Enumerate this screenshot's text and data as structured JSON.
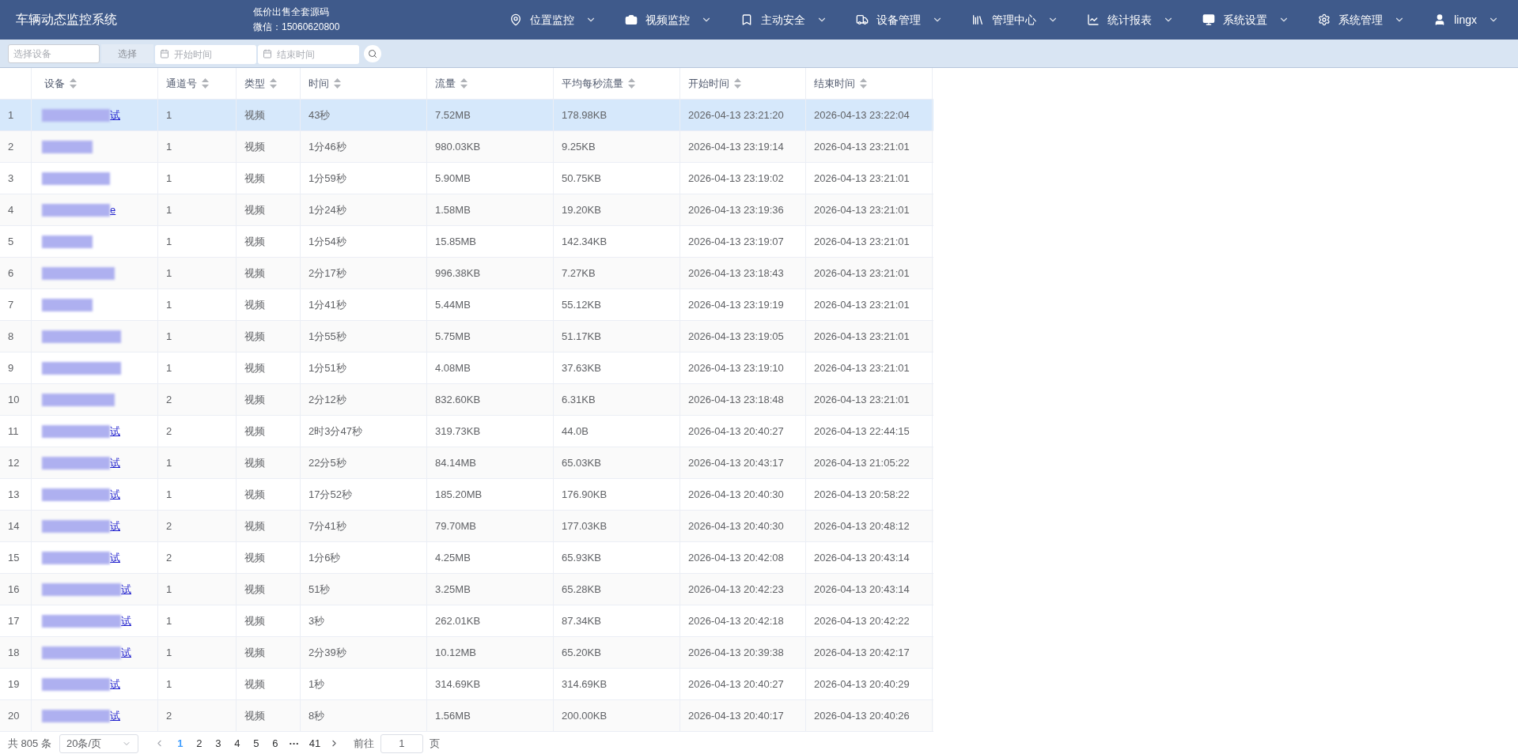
{
  "header": {
    "title": "车辆动态监控系统",
    "promo_line_1": "低价出售全套源码",
    "promo_line_2": "微信：15060620800",
    "nav": [
      {
        "kind": "location",
        "label": "位置监控"
      },
      {
        "kind": "video",
        "label": "视频监控"
      },
      {
        "kind": "safety",
        "label": "主动安全"
      },
      {
        "kind": "device",
        "label": "设备管理"
      },
      {
        "kind": "center",
        "label": "管理中心"
      },
      {
        "kind": "stats",
        "label": "统计报表"
      },
      {
        "kind": "system",
        "label": "系统设置"
      },
      {
        "kind": "admin",
        "label": "系统管理"
      },
      {
        "kind": "user",
        "label": "lingx"
      }
    ]
  },
  "toolbar": {
    "device_placeholder": "选择设备",
    "select_button": "选择",
    "start_placeholder": "开始时间",
    "end_placeholder": "结束时间"
  },
  "table": {
    "columns": [
      "设备",
      "通道号",
      "类型",
      "时间",
      "流量",
      "平均每秒流量",
      "开始时间",
      "结束时间"
    ],
    "rows": [
      {
        "index": "1",
        "device_tail": "试",
        "selected": true,
        "channel": "1",
        "type": "视频",
        "duration": "43秒",
        "traffic": "7.52MB",
        "avg": "178.98KB",
        "start": "2026-04-13 23:21:20",
        "end": "2026-04-13 23:22:04"
      },
      {
        "index": "2",
        "selected": false,
        "channel": "1",
        "type": "视频",
        "duration": "1分46秒",
        "traffic": "980.03KB",
        "avg": "9.25KB",
        "start": "2026-04-13 23:19:14",
        "end": "2026-04-13 23:21:01"
      },
      {
        "index": "3",
        "selected": false,
        "channel": "1",
        "type": "视频",
        "duration": "1分59秒",
        "traffic": "5.90MB",
        "avg": "50.75KB",
        "start": "2026-04-13 23:19:02",
        "end": "2026-04-13 23:21:01"
      },
      {
        "index": "4",
        "device_tail": "e",
        "selected": false,
        "channel": "1",
        "type": "视频",
        "duration": "1分24秒",
        "traffic": "1.58MB",
        "avg": "19.20KB",
        "start": "2026-04-13 23:19:36",
        "end": "2026-04-13 23:21:01"
      },
      {
        "index": "5",
        "selected": false,
        "channel": "1",
        "type": "视频",
        "duration": "1分54秒",
        "traffic": "15.85MB",
        "avg": "142.34KB",
        "start": "2026-04-13 23:19:07",
        "end": "2026-04-13 23:21:01"
      },
      {
        "index": "6",
        "selected": false,
        "channel": "1",
        "type": "视频",
        "duration": "2分17秒",
        "traffic": "996.38KB",
        "avg": "7.27KB",
        "start": "2026-04-13 23:18:43",
        "end": "2026-04-13 23:21:01"
      },
      {
        "index": "7",
        "selected": false,
        "channel": "1",
        "type": "视频",
        "duration": "1分41秒",
        "traffic": "5.44MB",
        "avg": "55.12KB",
        "start": "2026-04-13 23:19:19",
        "end": "2026-04-13 23:21:01"
      },
      {
        "index": "8",
        "selected": false,
        "channel": "1",
        "type": "视频",
        "duration": "1分55秒",
        "traffic": "5.75MB",
        "avg": "51.17KB",
        "start": "2026-04-13 23:19:05",
        "end": "2026-04-13 23:21:01"
      },
      {
        "index": "9",
        "selected": false,
        "channel": "1",
        "type": "视频",
        "duration": "1分51秒",
        "traffic": "4.08MB",
        "avg": "37.63KB",
        "start": "2026-04-13 23:19:10",
        "end": "2026-04-13 23:21:01"
      },
      {
        "index": "10",
        "selected": false,
        "channel": "2",
        "type": "视频",
        "duration": "2分12秒",
        "traffic": "832.60KB",
        "avg": "6.31KB",
        "start": "2026-04-13 23:18:48",
        "end": "2026-04-13 23:21:01"
      },
      {
        "index": "11",
        "device_tail": "试",
        "selected": false,
        "channel": "2",
        "type": "视频",
        "duration": "2时3分47秒",
        "traffic": "319.73KB",
        "avg": "44.0B",
        "start": "2026-04-13 20:40:27",
        "end": "2026-04-13 22:44:15"
      },
      {
        "index": "12",
        "device_tail": "试",
        "selected": false,
        "channel": "1",
        "type": "视频",
        "duration": "22分5秒",
        "traffic": "84.14MB",
        "avg": "65.03KB",
        "start": "2026-04-13 20:43:17",
        "end": "2026-04-13 21:05:22"
      },
      {
        "index": "13",
        "device_tail": "试",
        "selected": false,
        "channel": "1",
        "type": "视频",
        "duration": "17分52秒",
        "traffic": "185.20MB",
        "avg": "176.90KB",
        "start": "2026-04-13 20:40:30",
        "end": "2026-04-13 20:58:22"
      },
      {
        "index": "14",
        "device_tail": "试",
        "selected": false,
        "channel": "2",
        "type": "视频",
        "duration": "7分41秒",
        "traffic": "79.70MB",
        "avg": "177.03KB",
        "start": "2026-04-13 20:40:30",
        "end": "2026-04-13 20:48:12"
      },
      {
        "index": "15",
        "device_tail": "试",
        "selected": false,
        "channel": "2",
        "type": "视频",
        "duration": "1分6秒",
        "traffic": "4.25MB",
        "avg": "65.93KB",
        "start": "2026-04-13 20:42:08",
        "end": "2026-04-13 20:43:14"
      },
      {
        "index": "16",
        "device_tail": "试",
        "selected": false,
        "channel": "1",
        "type": "视频",
        "duration": "51秒",
        "traffic": "3.25MB",
        "avg": "65.28KB",
        "start": "2026-04-13 20:42:23",
        "end": "2026-04-13 20:43:14"
      },
      {
        "index": "17",
        "device_tail": "试",
        "selected": false,
        "channel": "1",
        "type": "视频",
        "duration": "3秒",
        "traffic": "262.01KB",
        "avg": "87.34KB",
        "start": "2026-04-13 20:42:18",
        "end": "2026-04-13 20:42:22"
      },
      {
        "index": "18",
        "device_tail": "试",
        "selected": false,
        "channel": "1",
        "type": "视频",
        "duration": "2分39秒",
        "traffic": "10.12MB",
        "avg": "65.20KB",
        "start": "2026-04-13 20:39:38",
        "end": "2026-04-13 20:42:17"
      },
      {
        "index": "19",
        "device_tail": "试",
        "selected": false,
        "channel": "1",
        "type": "视频",
        "duration": "1秒",
        "traffic": "314.69KB",
        "avg": "314.69KB",
        "start": "2026-04-13 20:40:27",
        "end": "2026-04-13 20:40:29"
      },
      {
        "index": "20",
        "device_tail": "试",
        "selected": false,
        "channel": "2",
        "type": "视频",
        "duration": "8秒",
        "traffic": "1.56MB",
        "avg": "200.00KB",
        "start": "2026-04-13 20:40:17",
        "end": "2026-04-13 20:40:26"
      }
    ]
  },
  "pagination": {
    "total": "共 805 条",
    "page_size": "20条/页",
    "pages": [
      {
        "label": "1",
        "selected": true
      },
      {
        "label": "2",
        "selected": false
      },
      {
        "label": "3",
        "selected": false
      },
      {
        "label": "4",
        "selected": false
      },
      {
        "label": "5",
        "selected": false
      },
      {
        "label": "6",
        "selected": false
      }
    ],
    "ellipsis": "···",
    "last_page": "41",
    "goto_label": "前往",
    "goto_value": "1",
    "page_suffix": "页"
  }
}
